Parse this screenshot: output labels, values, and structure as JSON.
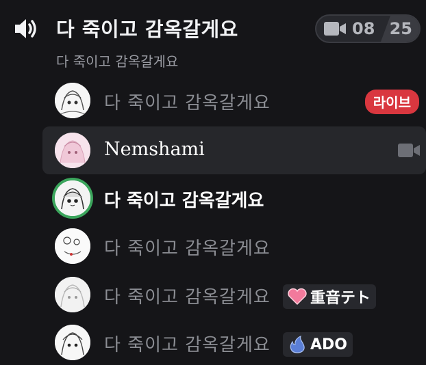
{
  "channel": {
    "name": "다 죽이고 감옥갈게요",
    "subtitle": "다 죽이고 감옥갈게요",
    "video_count": "08",
    "user_limit": "25"
  },
  "members": [
    {
      "name": "다 죽이고 감옥갈게요",
      "badge": "라이브"
    },
    {
      "name": "Nemshami",
      "camera_on": true
    },
    {
      "name": "다 죽이고 감옥갈게요",
      "speaking": true
    },
    {
      "name": "다 죽이고 감옥갈게요"
    },
    {
      "name": "다 죽이고 감옥갈게요",
      "tag": {
        "icon": "pink-heart-icon",
        "text": "重音テト"
      }
    },
    {
      "name": "다 죽이고 감옥갈게요",
      "tag": {
        "icon": "blue-flame-icon",
        "text": "ADO"
      }
    }
  ],
  "colors": {
    "background": "#151518",
    "live_badge": "#d9373f",
    "speaking_ring": "#3ba55c"
  }
}
